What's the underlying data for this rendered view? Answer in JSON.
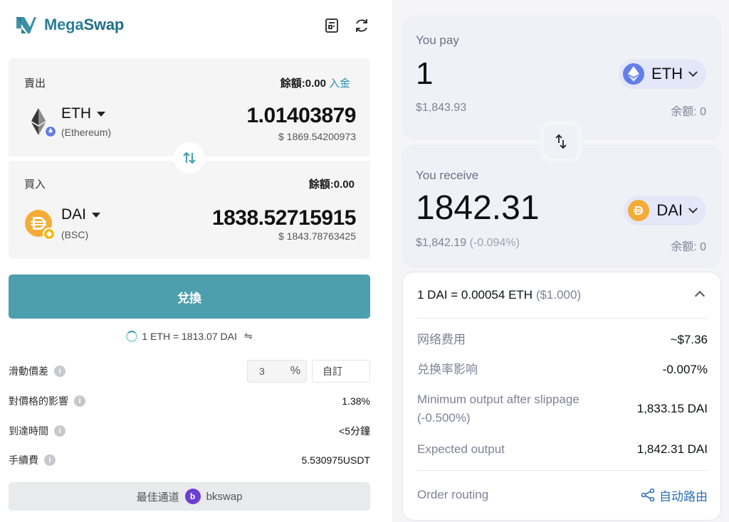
{
  "left": {
    "app_name_part1": "Mega",
    "app_name_part2": "Swap",
    "header_icons": [
      "receipt-icon",
      "refresh-icon"
    ],
    "sell": {
      "label": "賣出",
      "balance": "餘額:0.00",
      "deposit_link": "入金",
      "token": "ETH",
      "chain": "(Ethereum)",
      "amount": "1.01403879",
      "usd": "$ 1869.54200973"
    },
    "buy": {
      "label": "買入",
      "balance": "餘額:0.00",
      "token": "DAI",
      "chain": "(BSC)",
      "amount": "1838.52715915",
      "usd": "$ 1843.78763425"
    },
    "swap_button": "兌換",
    "rate": "1 ETH = 1813.07 DAI",
    "rate_swap_glyph": "⇋",
    "rows": [
      {
        "label": "滑動價差"
      },
      {
        "label": "對價格的影響",
        "value": "1.38%"
      },
      {
        "label": "到達時間",
        "value": "<5分鐘"
      },
      {
        "label": "手續費",
        "value": "5.530975USDT"
      }
    ],
    "slippage": {
      "value": "3",
      "unit": "%",
      "custom_placeholder": "自訂"
    },
    "route_prefix": "最佳通道",
    "route_name": "bkswap"
  },
  "right": {
    "pay": {
      "label": "You pay",
      "amount": "1",
      "usd": "$1,843.93",
      "token": "ETH",
      "balance": "余额:  0"
    },
    "receive": {
      "label": "You receive",
      "amount": "1842.31",
      "usd": "$1,842.19",
      "usd_change": "(-0.094%)",
      "token": "DAI",
      "balance": "余额:  0"
    },
    "details": {
      "rate": "1 DAI = 0.00054 ETH",
      "rate_usd": "($1.000)",
      "rows": [
        {
          "label": "网络费用",
          "value": "~$7.36"
        },
        {
          "label": "兑换率影响",
          "value": "-0.007%"
        },
        {
          "label": "Minimum output after slippage (-0.500%)",
          "value": "1,833.15 DAI"
        },
        {
          "label": "Expected output",
          "value": "1,842.31 DAI"
        }
      ],
      "routing_label": "Order routing",
      "routing_value": "自动路由"
    }
  },
  "colors": {
    "brand": "#2a7f96",
    "swap_button": "#4e9fae",
    "eth": "#627eea",
    "dai": "#f5ac37",
    "link": "#2b8fb0",
    "routing": "#2e6fb3"
  }
}
